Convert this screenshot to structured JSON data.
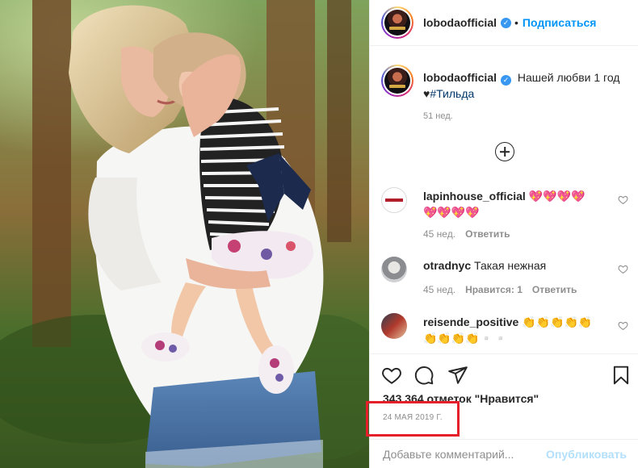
{
  "header": {
    "username": "lobodaofficial",
    "separator": "•",
    "follow_label": "Подписаться"
  },
  "caption": {
    "username": "lobodaofficial",
    "text": "Нашей любви 1 год",
    "heart": "♥",
    "hashtag": "#Тильда",
    "time": "51 нед."
  },
  "comments": [
    {
      "username": "lapinhouse_official",
      "text": "💖💖💖💖💖💖💖💖",
      "time": "45 нед.",
      "reply_label": "Ответить",
      "likes_label": ""
    },
    {
      "username": "otradnyc",
      "text": "Такая нежная",
      "time": "45 нед.",
      "likes_label": "Нравится: 1",
      "reply_label": "Ответить"
    },
    {
      "username": "reisende_positive",
      "text": "👏👏👏👏👏👏👏👏👏▫️▫️",
      "time": "",
      "likes_label": "",
      "reply_label": ""
    }
  ],
  "icons": {
    "like": "heart-outline-icon",
    "comment": "speech-bubble-icon",
    "share": "paper-plane-icon",
    "save": "bookmark-icon",
    "load_more": "plus-circle-icon",
    "verified": "verified-badge-icon"
  },
  "likes_count": "343 364 отметок \"Нравится\"",
  "post_date": "24 МАЯ 2019 Г.",
  "add_comment": {
    "placeholder": "Добавьте комментарий...",
    "publish_label": "Опубликовать"
  },
  "colors": {
    "accent": "#0095f6",
    "publish_disabled": "#b2dffc",
    "secondary_text": "#8e8e8e",
    "highlight_box": "#e5202b"
  }
}
